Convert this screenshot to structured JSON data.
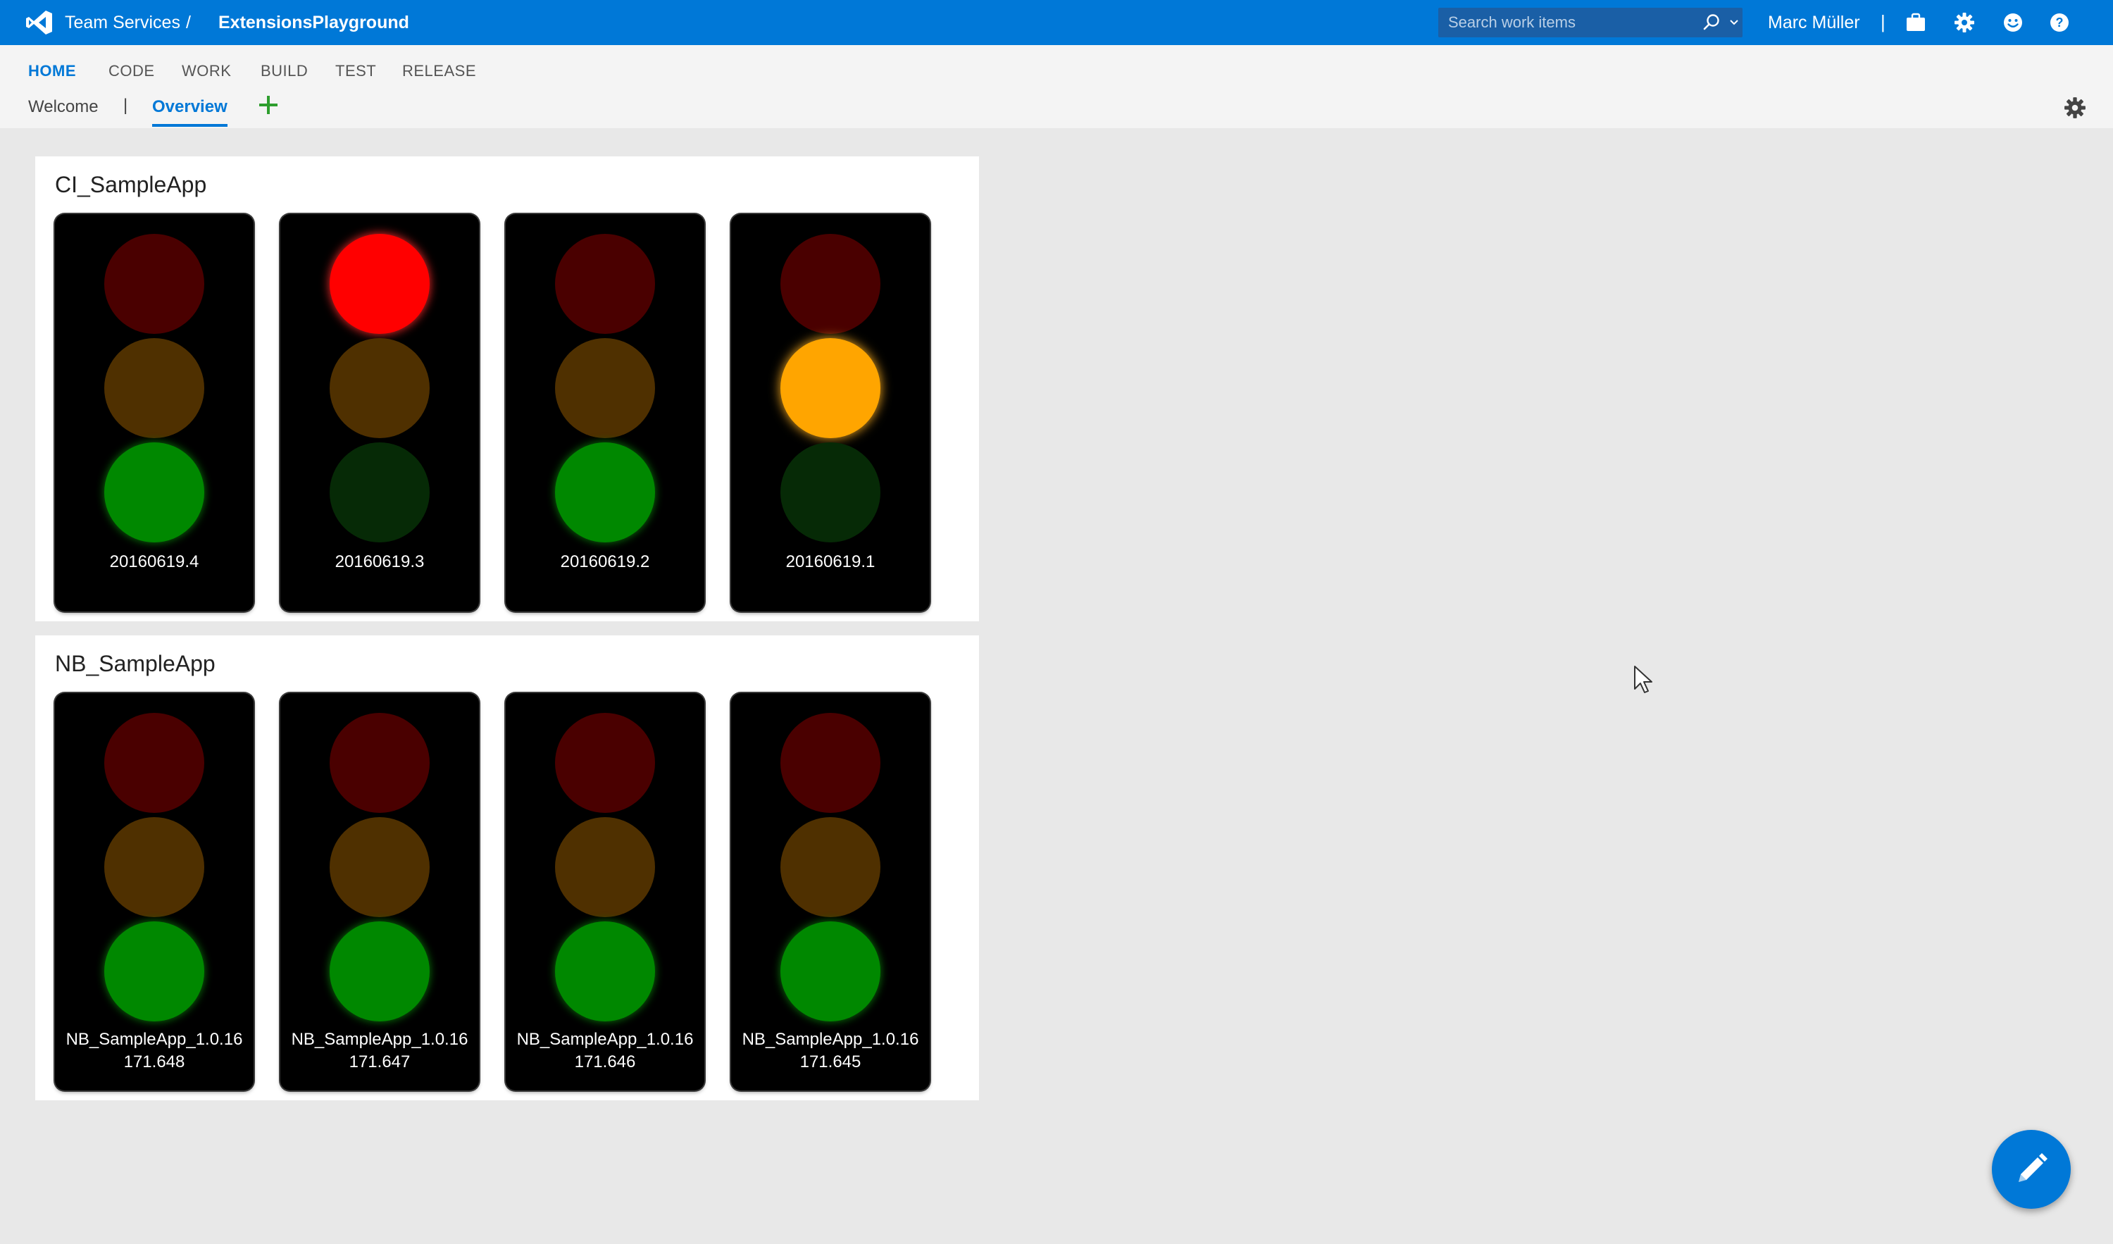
{
  "header": {
    "brand": "Team Services",
    "separator": "/",
    "project": "ExtensionsPlayground",
    "search_placeholder": "Search work items",
    "user": "Marc Müller",
    "user_separator": "|"
  },
  "hubs": [
    {
      "label": "HOME",
      "active": true
    },
    {
      "label": "CODE"
    },
    {
      "label": "WORK"
    },
    {
      "label": "BUILD"
    },
    {
      "label": "TEST"
    },
    {
      "label": "RELEASE"
    }
  ],
  "tabs": {
    "welcome": "Welcome",
    "separator": "|",
    "overview": "Overview",
    "add_symbol": "+"
  },
  "widgets": [
    {
      "title": "CI_SampleApp",
      "lights": [
        {
          "label": "20160619.4",
          "lit": "green"
        },
        {
          "label": "20160619.3",
          "lit": "red"
        },
        {
          "label": "20160619.2",
          "lit": "green"
        },
        {
          "label": "20160619.1",
          "lit": "yellow"
        }
      ]
    },
    {
      "title": "NB_SampleApp",
      "lights": [
        {
          "label_line1": "NB_SampleApp_1.0.16",
          "label_line2": "171.648",
          "lit": "green"
        },
        {
          "label_line1": "NB_SampleApp_1.0.16",
          "label_line2": "171.647",
          "lit": "green"
        },
        {
          "label_line1": "NB_SampleApp_1.0.16",
          "label_line2": "171.646",
          "lit": "green"
        },
        {
          "label_line1": "NB_SampleApp_1.0.16",
          "label_line2": "171.645",
          "lit": "green"
        }
      ]
    }
  ],
  "icons": {
    "logo": "visual-studio-logo-icon",
    "search": "search-icon",
    "shopping": "shopping-bag-icon",
    "settings": "gear-icon",
    "feedback": "smiley-icon",
    "help": "help-icon",
    "edit": "pencil-icon"
  },
  "colors": {
    "brand_blue": "#0078d7",
    "red_on": "#ff0000",
    "yellow_on": "#ffa500",
    "green_on": "#008800"
  }
}
